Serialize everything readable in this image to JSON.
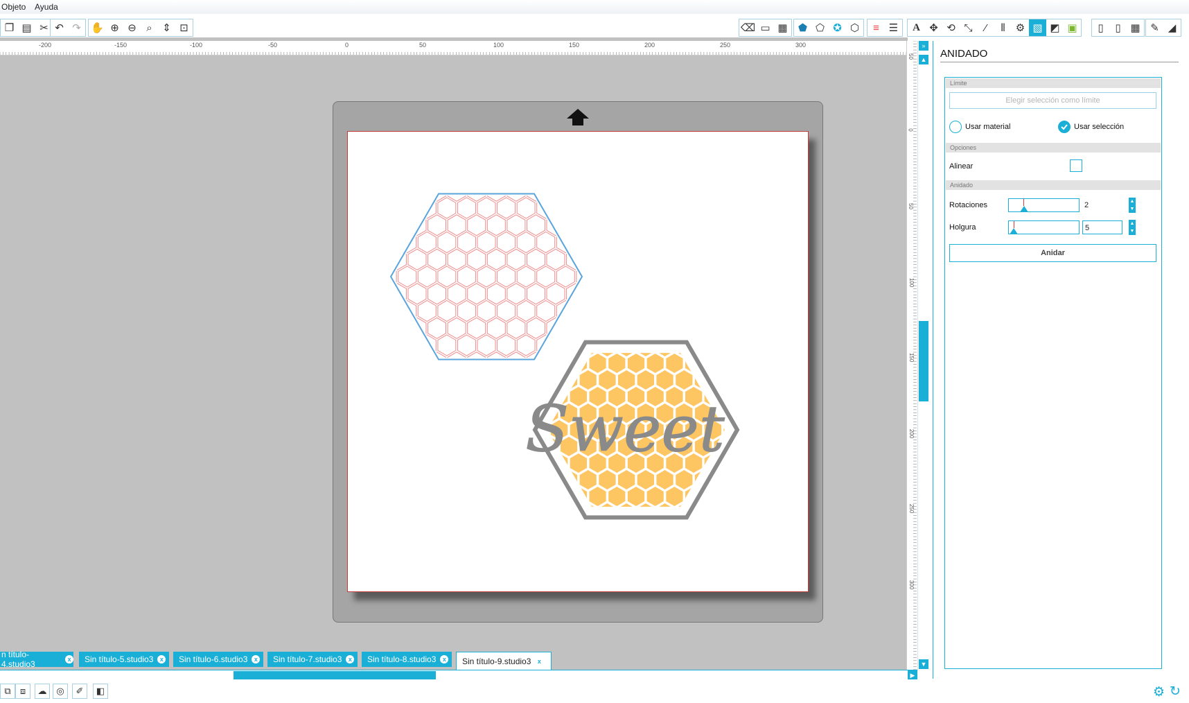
{
  "menu": {
    "items": [
      "Objeto",
      "Ayuda"
    ]
  },
  "toolbar": {
    "left_icons": [
      "copy-icon",
      "paste-icon",
      "cut-icon",
      "undo-icon",
      "redo-icon",
      "pan-icon",
      "zoom-in-icon",
      "zoom-out-icon",
      "zoom-select-icon",
      "zoom-drag-icon",
      "fit-to-page-icon"
    ],
    "right_icons": [
      "eraser-icon",
      "page-setup-icon",
      "grid-icon",
      "fill-icon",
      "pattern-icon",
      "gradient-icon",
      "effects-icon",
      "line-color-icon",
      "line-style-icon",
      "text-style-icon",
      "transform-icon",
      "rotate-icon",
      "scale-icon",
      "shear-icon",
      "align-icon",
      "replicate-icon",
      "nest-icon",
      "modify-icon",
      "trace-icon",
      "offset-icon",
      "send-icon",
      "cut-settings-icon",
      "pixscan-icon",
      "library-icon"
    ]
  },
  "ruler": {
    "h_labels": [
      "-200",
      "-150",
      "-100",
      "-50",
      "0",
      "50",
      "100",
      "150",
      "200",
      "250",
      "300"
    ],
    "v_labels": [
      "50",
      "0",
      "50",
      "100",
      "150",
      "200",
      "250",
      "300"
    ]
  },
  "design": {
    "title_word": "Sweet"
  },
  "tabs": [
    {
      "label": "n título-4.studio3",
      "active": false
    },
    {
      "label": "Sin título-5.studio3",
      "active": false
    },
    {
      "label": "Sin título-6.studio3",
      "active": false
    },
    {
      "label": "Sin título-7.studio3",
      "active": false
    },
    {
      "label": "Sin título-8.studio3",
      "active": false
    },
    {
      "label": "Sin título-9.studio3",
      "active": true
    }
  ],
  "tab_close": "x",
  "panel": {
    "title": "ANIDADO",
    "limit": {
      "header": "Límite",
      "button": "Elegir selección como límite",
      "use_material": "Usar material",
      "use_selection": "Usar selección",
      "selected": "use_selection"
    },
    "options": {
      "header": "Opciones",
      "align_label": "Alinear",
      "align_checked": false
    },
    "nesting": {
      "header": "Anidado",
      "rotations_label": "Rotaciones",
      "rotations_value": "2",
      "spacing_label": "Holgura",
      "spacing_value": "5",
      "nest_button": "Anidar"
    }
  },
  "colors": {
    "accent": "#1aafd7",
    "honey": "#fdc662",
    "hex_outline": "#5aa4dd",
    "cell_outline": "#ef8b8b",
    "frame_gray": "#8a8a8a"
  },
  "bottombar": {
    "icons": [
      "group-icon",
      "ungroup-icon",
      "cloud-icon",
      "target-icon",
      "knife-icon",
      "layer-icon"
    ],
    "right_icons": [
      "settings-gear-icon",
      "sync-icon"
    ]
  }
}
